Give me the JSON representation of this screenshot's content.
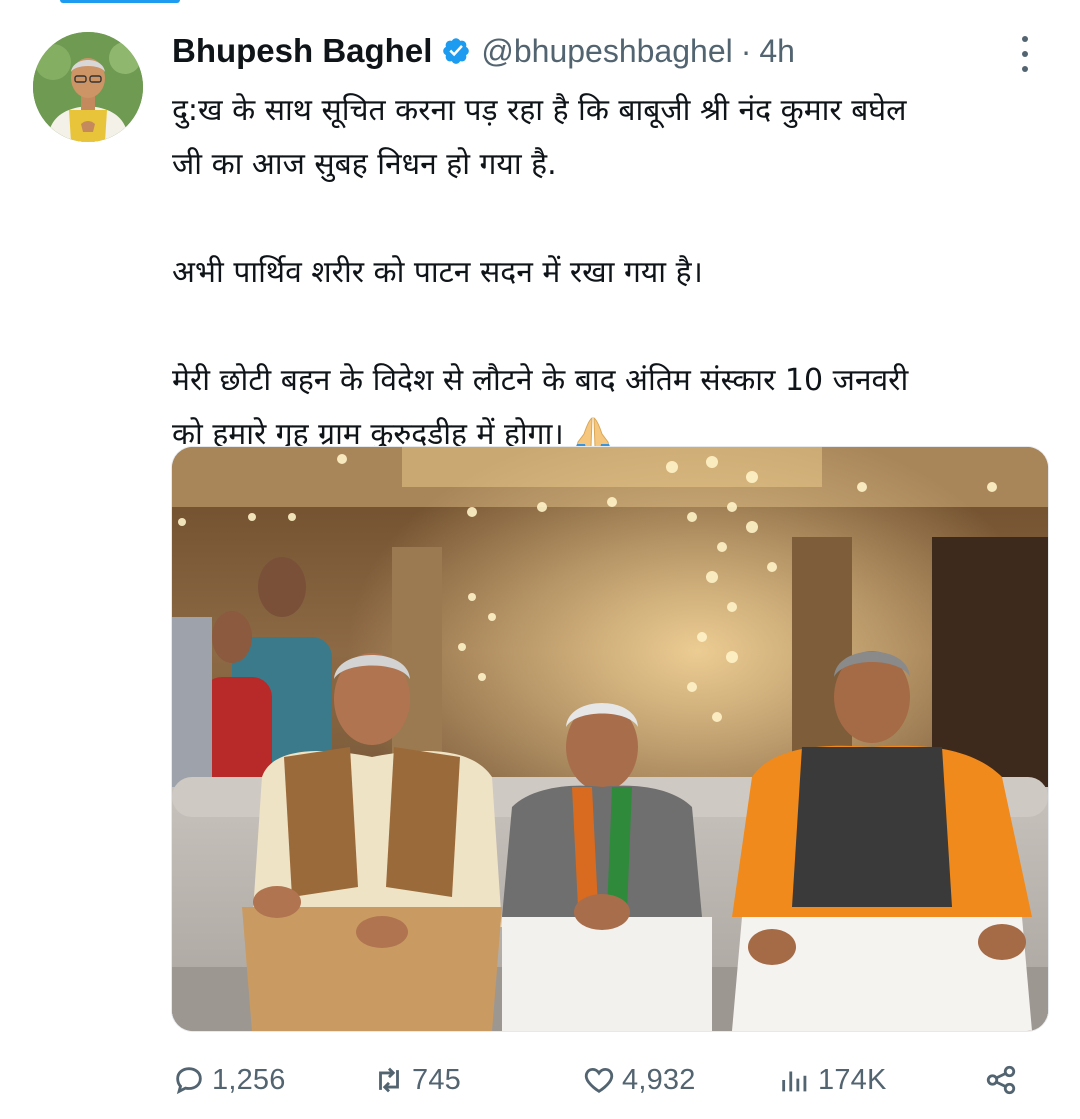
{
  "author": {
    "display_name": "Bhupesh Baghel",
    "handle": "@bhupeshbaghel",
    "separator": "·",
    "time_ago": "4h",
    "verified": true
  },
  "tweet": {
    "lines": [
      "दु:ख के साथ सूचित करना पड़ रहा है कि बाबूजी श्री नंद कुमार बघेल",
      "जी का आज सुबह निधन हो गया है.",
      "अभी पार्थिव शरीर को पाटन सदन में रखा गया है।",
      "मेरी छोटी बहन के विदेश से लौटने के बाद अंतिम संस्कार 10 जनवरी",
      "को हमारे गृह ग्राम कुरुदडीह में होगा।"
    ],
    "emoji": "folded-hands-emoji"
  },
  "actions": {
    "replies": "1,256",
    "retweets": "745",
    "likes": "4,932",
    "views": "174K"
  },
  "colors": {
    "accent": "#1d9bf0",
    "text": "#0f1419",
    "muted": "#536471"
  },
  "icons": [
    "verified-badge-icon",
    "more-icon",
    "reply-icon",
    "retweet-icon",
    "like-icon",
    "views-icon",
    "share-icon"
  ]
}
